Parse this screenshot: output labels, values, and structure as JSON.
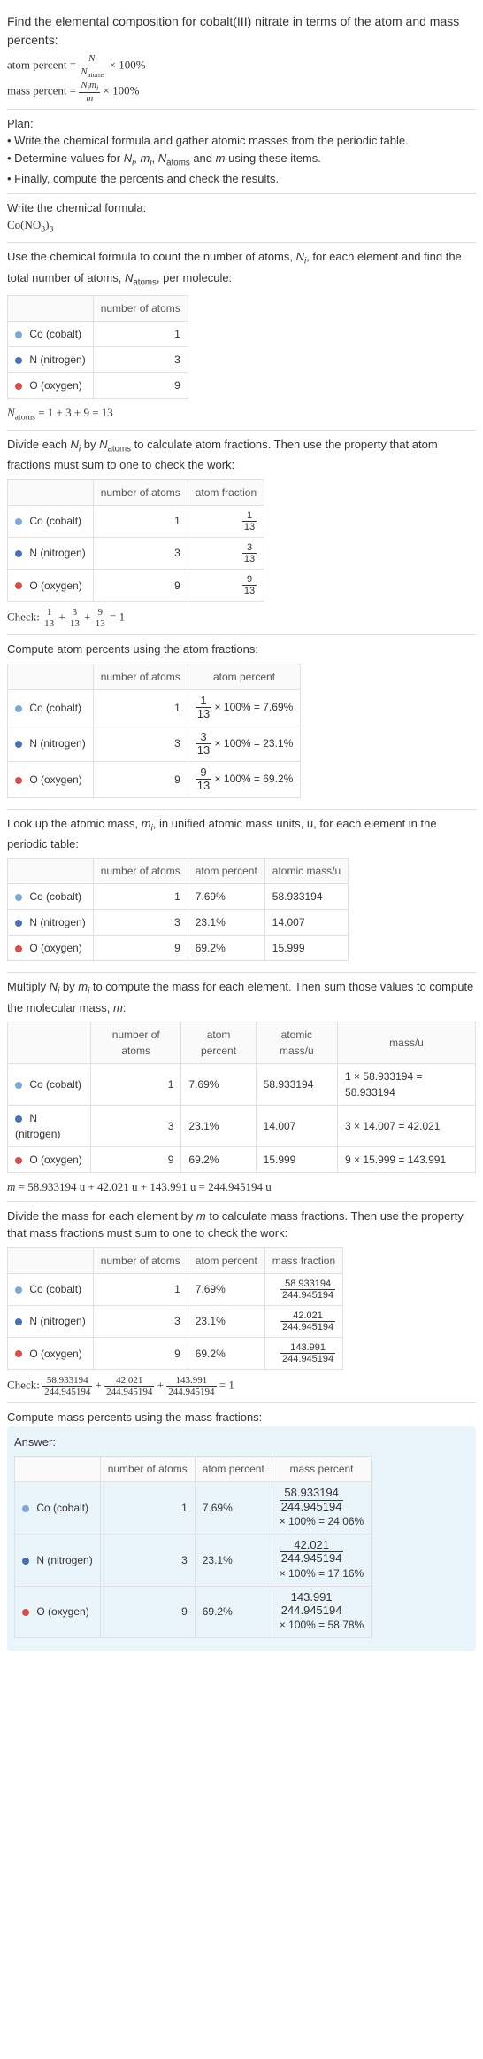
{
  "question": {
    "line1": "Find the elemental composition for cobalt(III) nitrate in terms of the atom and mass percents:",
    "atom_eq_l": "atom percent = ",
    "atom_eq_r": " × 100%",
    "mass_eq_l": "mass percent = ",
    "mass_eq_r": " × 100%",
    "Ni": "N",
    "Ni_i": "i",
    "Natoms": "N",
    "Natoms_sub": "atoms",
    "Nimi": "N",
    "Nimi_i": "i",
    "m": "m",
    "m_i": "i"
  },
  "plan": {
    "title": "Plan:",
    "b1": "• Write the chemical formula and gather atomic masses from the periodic table.",
    "b2_a": "• Determine values for ",
    "b2_b": ", ",
    "b2_c": ", ",
    "b2_d": " and ",
    "b2_e": " using these items.",
    "b3": "• Finally, compute the percents and check the results."
  },
  "s1": {
    "title": "Write the chemical formula:",
    "formula": "Co(NO",
    "sub1": "3",
    "mid": ")",
    "sub2": "3"
  },
  "s2": {
    "text_a": "Use the chemical formula to count the number of atoms, ",
    "text_b": ", for each element and find the total number of atoms, ",
    "text_c": ", per molecule:",
    "h_atoms": "number of atoms",
    "co": " Co (cobalt)",
    "co_n": "1",
    "n": " N (nitrogen)",
    "n_n": "3",
    "o": " O (oxygen)",
    "o_n": "9",
    "total": " = 1 + 3 + 9 = 13"
  },
  "s3": {
    "text_a": "Divide each ",
    "text_b": " by ",
    "text_c": " to calculate atom fractions. Then use the property that atom fractions must sum to one to check the work:",
    "h1": "number of atoms",
    "h2": "atom fraction",
    "co_n": "1",
    "co_f": "1",
    "co_d": "13",
    "n_n": "3",
    "n_f": "3",
    "n_d": "13",
    "o_n": "9",
    "o_f": "9",
    "o_d": "13",
    "check_l": "Check: ",
    "check_r": " = 1"
  },
  "s4_title": "Compute atom percents using the atom fractions:",
  "s4": {
    "h1": "number of atoms",
    "h2": "atom percent",
    "co_n": "1",
    "co_p": " × 100% = 7.69%",
    "n_n": "3",
    "n_p": " × 100% = 23.1%",
    "o_n": "9",
    "o_p": " × 100% = 69.2%"
  },
  "s5": {
    "text_a": "Look up the atomic mass, ",
    "text_b": ", in unified atomic mass units, u, for each element in the periodic table:",
    "h1": "number of atoms",
    "h2": "atom percent",
    "h3": "atomic mass/u",
    "co_n": "1",
    "co_p": "7.69%",
    "co_m": "58.933194",
    "n_n": "3",
    "n_p": "23.1%",
    "n_m": "14.007",
    "o_n": "9",
    "o_p": "69.2%",
    "o_m": "15.999"
  },
  "s6": {
    "text_a": "Multiply ",
    "text_b": " by ",
    "text_c": " to compute the mass for each element. Then sum those values to compute the molecular mass, ",
    "text_d": ":",
    "h1": "number of atoms",
    "h2": "atom percent",
    "h3": "atomic mass/u",
    "h4": "mass/u",
    "co_n": "1",
    "co_p": "7.69%",
    "co_m": "58.933194",
    "co_mass": "1 × 58.933194 = 58.933194",
    "n_n": "3",
    "n_p": "23.1%",
    "n_m": "14.007",
    "n_mass": "3 × 14.007 = 42.021",
    "o_n": "9",
    "o_p": "69.2%",
    "o_m": "15.999",
    "o_mass": "9 × 15.999 = 143.991",
    "total": " = 58.933194 u + 42.021 u + 143.991 u = 244.945194 u"
  },
  "s7": {
    "text": "Divide the mass for each element by ",
    "text_b": " to calculate mass fractions. Then use the property that mass fractions must sum to one to check the work:",
    "h1": "number of atoms",
    "h2": "atom percent",
    "h3": "mass fraction",
    "co_n": "1",
    "co_p": "7.69%",
    "co_f": "58.933194",
    "co_d": "244.945194",
    "n_n": "3",
    "n_p": "23.1%",
    "n_f": "42.021",
    "n_d": "244.945194",
    "o_n": "9",
    "o_p": "69.2%",
    "o_f": "143.991",
    "o_d": "244.945194",
    "check_l": "Check: ",
    "check_r": " = 1"
  },
  "s8_title": "Compute mass percents using the mass fractions:",
  "answer_label": "Answer:",
  "ans": {
    "h1": "number of atoms",
    "h2": "atom percent",
    "h3": "mass percent",
    "co_n": "1",
    "co_p": "7.69%",
    "co_f": "58.933194",
    "co_d": "244.945194",
    "co_r": "× 100% = 24.06%",
    "n_n": "3",
    "n_p": "23.1%",
    "n_f": "42.021",
    "n_d": "244.945194",
    "n_r": "× 100% = 17.16%",
    "o_n": "9",
    "o_p": "69.2%",
    "o_f": "143.991",
    "o_d": "244.945194",
    "o_r": "× 100% = 58.78%"
  },
  "chart_data": {
    "type": "table",
    "title": "Elemental composition of cobalt(III) nitrate Co(NO3)3",
    "N_atoms_total": 13,
    "molecular_mass_u": 244.945194,
    "rows": [
      {
        "element": "Co (cobalt)",
        "atoms": 1,
        "atom_fraction": "1/13",
        "atom_percent": 7.69,
        "atomic_mass_u": 58.933194,
        "mass_u": 58.933194,
        "mass_fraction": "58.933194/244.945194",
        "mass_percent": 24.06
      },
      {
        "element": "N (nitrogen)",
        "atoms": 3,
        "atom_fraction": "3/13",
        "atom_percent": 23.1,
        "atomic_mass_u": 14.007,
        "mass_u": 42.021,
        "mass_fraction": "42.021/244.945194",
        "mass_percent": 17.16
      },
      {
        "element": "O (oxygen)",
        "atoms": 9,
        "atom_fraction": "9/13",
        "atom_percent": 69.2,
        "atomic_mass_u": 15.999,
        "mass_u": 143.991,
        "mass_fraction": "143.991/244.945194",
        "mass_percent": 58.78
      }
    ]
  }
}
